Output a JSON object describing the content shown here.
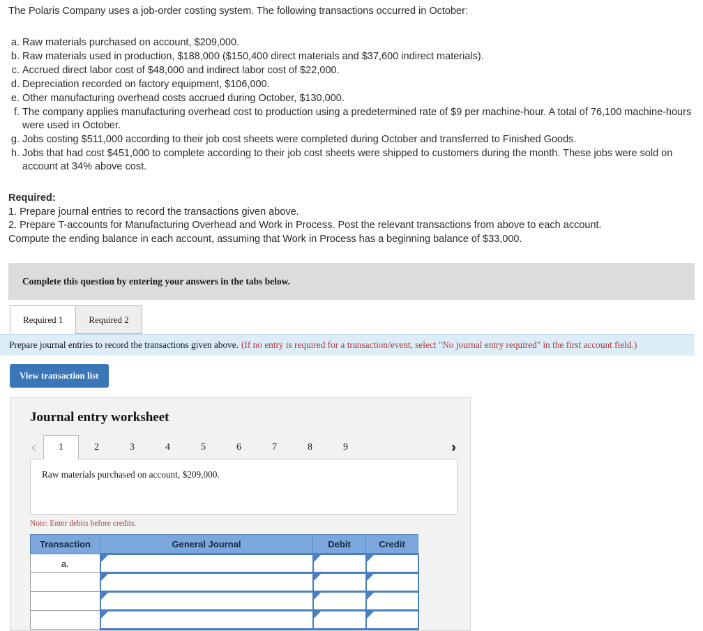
{
  "problem": {
    "intro": "The Polaris Company uses a job-order costing system. The following transactions occurred in October:",
    "transactions": [
      {
        "letter": "a.",
        "text": "Raw materials purchased on account, $209,000."
      },
      {
        "letter": "b.",
        "text": "Raw materials used in production, $188,000 ($150,400 direct materials and $37,600 indirect materials)."
      },
      {
        "letter": "c.",
        "text": "Accrued direct labor cost of $48,000 and indirect labor cost of $22,000."
      },
      {
        "letter": "d.",
        "text": "Depreciation recorded on factory equipment, $106,000."
      },
      {
        "letter": "e.",
        "text": "Other manufacturing overhead costs accrued during October, $130,000."
      },
      {
        "letter": "f.",
        "text": "The company applies manufacturing overhead cost to production using a predetermined rate of $9 per machine-hour. A total of 76,100 machine-hours were used in October."
      },
      {
        "letter": "g.",
        "text": "Jobs costing $511,000 according to their job cost sheets were completed during October and transferred to Finished Goods."
      },
      {
        "letter": "h.",
        "text": "Jobs that had cost $451,000 to complete according to their job cost sheets were shipped to customers during the month. These jobs were sold on account at 34% above cost."
      }
    ],
    "required_title": "Required:",
    "required_lines": [
      "1. Prepare journal entries to record the transactions given above.",
      "2. Prepare T-accounts for Manufacturing Overhead and Work in Process. Post the relevant transactions from above to each account.",
      "Compute the ending balance in each account, assuming that Work in Process has a beginning balance of $33,000."
    ]
  },
  "callout": {
    "text": "Complete this question by entering your answers in the tabs below."
  },
  "tabs": [
    {
      "label": "Required 1",
      "active": true
    },
    {
      "label": "Required 2",
      "active": false
    }
  ],
  "instruction": {
    "main": "Prepare journal entries to record the transactions given above.",
    "note": "(If no entry is required for a transaction/event, select \"No journal entry required\" in the first account field.)"
  },
  "buttons": {
    "view_transaction_list": "View transaction list"
  },
  "worksheet": {
    "title": "Journal entry worksheet",
    "pager": {
      "prev_icon": "chevron-left-icon",
      "next_icon": "chevron-right-icon",
      "pages": [
        "1",
        "2",
        "3",
        "4",
        "5",
        "6",
        "7",
        "8",
        "9"
      ],
      "active_page": "1"
    },
    "description": "Raw materials purchased on account, $209,000.",
    "note": "Note: Enter debits before credits.",
    "table": {
      "headers": [
        "Transaction",
        "General Journal",
        "Debit",
        "Credit"
      ],
      "rows": [
        {
          "transaction": "a.",
          "general_journal": "",
          "debit": "",
          "credit": ""
        },
        {
          "transaction": "",
          "general_journal": "",
          "debit": "",
          "credit": ""
        },
        {
          "transaction": "",
          "general_journal": "",
          "debit": "",
          "credit": ""
        },
        {
          "transaction": "",
          "general_journal": "",
          "debit": "",
          "credit": ""
        }
      ]
    }
  },
  "colors": {
    "button_blue": "#3a76b8",
    "header_blue": "#7ba7dc",
    "instruction_bg": "#ddedf8",
    "callout_bg": "#dcdcdc",
    "red_note": "#b03a3a",
    "panel_bg": "#f2f2f2"
  }
}
